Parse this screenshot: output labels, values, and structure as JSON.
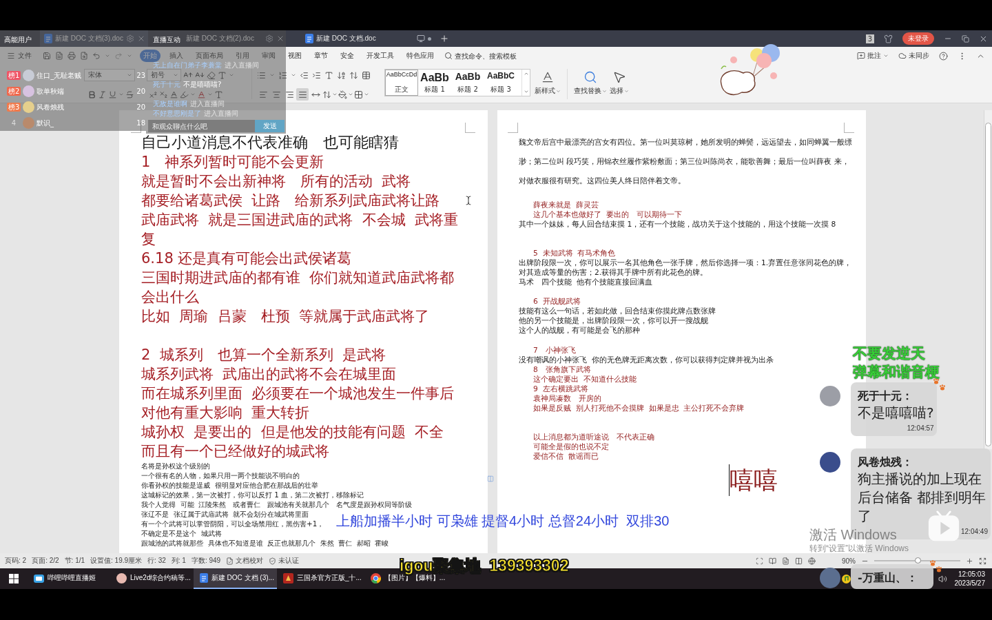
{
  "window": {
    "tabs": [
      {
        "label": "新建 DOC 文档(3).doc",
        "selected": true
      },
      {
        "label": "新建 DOC 文档(2).doc",
        "selected": false
      },
      {
        "label": "新建 DOC 文档.doc",
        "selected": false
      }
    ],
    "window_count": "3",
    "login_button": "未登录"
  },
  "menu": {
    "file": "文件",
    "tabs": [
      {
        "label": "开始",
        "selected": true
      },
      {
        "label": "插入",
        "selected": false
      },
      {
        "label": "页面布局",
        "selected": false
      },
      {
        "label": "引用",
        "selected": false
      },
      {
        "label": "审阅",
        "selected": false
      },
      {
        "label": "视图",
        "selected": false
      },
      {
        "label": "章节",
        "selected": false
      },
      {
        "label": "安全",
        "selected": false
      },
      {
        "label": "开发工具",
        "selected": false
      },
      {
        "label": "特色应用",
        "selected": false
      }
    ],
    "search": {
      "placeholder": "查找命令、搜索模板"
    },
    "comment": "批注",
    "sync": "未同步"
  },
  "ribbon": {
    "font_name": "宋体",
    "font_size": "初号",
    "align_buttons": [
      {
        "selected": false
      },
      {
        "selected": false
      },
      {
        "selected": false
      },
      {
        "selected": true
      },
      {
        "selected": false
      }
    ],
    "styles": [
      {
        "sample": "AaBbCcDd",
        "label": "正文",
        "selected": true
      },
      {
        "sample": "AaBb",
        "label": "标题 1",
        "selected": false
      },
      {
        "sample": "AaBb",
        "label": "标题 2",
        "selected": false
      },
      {
        "sample": "AaBbC",
        "label": "标题 3",
        "selected": false
      }
    ],
    "new_style": "新样式",
    "find_replace": "查找替换",
    "select": "选择"
  },
  "document": {
    "pages": [
      {
        "blocks": [
          {
            "lines": [
              {
                "kind": "title",
                "text": "自己小道消息不代表准确　也可能瞎猜"
              },
              {
                "kind": "large",
                "text": "1　神系列暂时可能不会更新"
              },
              {
                "kind": "large",
                "text": "就是暂时不会出新神将　所有的活动  武将"
              },
              {
                "kind": "large",
                "text": "都要给诸葛武侯  让路　给新系列武庙武将让路"
              },
              {
                "kind": "large",
                "text": "武庙武将  就是三国进武庙的武将  不会城  武将重"
              },
              {
                "kind": "large",
                "text": "复"
              },
              {
                "kind": "large",
                "text": "6.18 还是真有可能会出武侯诸葛"
              },
              {
                "kind": "large",
                "text": "三国时期进武庙的都有谁  你们就知道武庙武将都"
              },
              {
                "kind": "large",
                "text": "会出什么"
              },
              {
                "kind": "large",
                "text": "比如  周瑜  吕蒙　杜预  等就属于武庙武将了"
              }
            ]
          },
          {
            "lines": [
              {
                "kind": "large",
                "text": "2  城系列　也算一个全新系列  是武将"
              },
              {
                "kind": "large",
                "text": "城系列武将  武庙出的武将不会在城里面"
              },
              {
                "kind": "large",
                "text": "而在城系列里面  必须要在一个城池发生一件事后"
              },
              {
                "kind": "large",
                "text": "对他有重大影响  重大转折"
              },
              {
                "kind": "large",
                "text": "城孙权  是要出的  但是他发的技能有问题  不全"
              },
              {
                "kind": "large",
                "text": "而且有一个已经做好的城武将"
              },
              {
                "kind": "small",
                "text": "名将是孙权这个级别的"
              },
              {
                "kind": "small",
                "text": "一个很有名的人物，如果只用一两个技能说不明白的"
              },
              {
                "kind": "small",
                "text": "你看孙权的技能是逞威  很明显对应他合肥在那战后的壮举"
              },
              {
                "kind": "small",
                "text": "这城标记的效果，第一次被打，你可以反打 1 血，第二次被打，移除标记"
              },
              {
                "kind": "small",
                "text": "我个人觉得  可能  江陵朱然　或者曹仁　跟城池有关就那几个　名气度是跟孙权同等阶级"
              },
              {
                "kind": "small",
                "text": "张辽不是  张辽属于武庙武将  就不会划分在城武将里面"
              },
              {
                "kind": "small",
                "text": "有一个个武将可以掌管阴阳，可以全场禁用红，黑伤害+1，"
              },
              {
                "kind": "small",
                "text": "不确定是不是这个  城武将"
              },
              {
                "kind": "small",
                "text": "跟城池的武将就那些  具体也不知道是谁  反正也就那几个  朱然  曹仁  郝昭  霍峻"
              }
            ]
          }
        ]
      },
      {
        "blocks": [
          {
            "lines": [
              {
                "kind": "intro",
                "text": "魏文帝后宫中最漂亮的宫女有四位。第一位叫莫琼树，她所发明的蝉鬓，远远望去，如同蝉翼一般缥"
              },
              {
                "kind": "intro",
                "text": "渺；第二位叫 段巧笑，用锦衣丝履作紫粉敷面；第三位叫陈尚衣，能歌善舞；最后一位叫薛夜 来，"
              },
              {
                "kind": "intro",
                "text": "对做衣服很有研究。这四位美人终日陪伴着文帝。"
              }
            ]
          },
          {
            "lines": [
              {
                "kind": "note",
                "text": "薛夜来就是  薛灵芸"
              },
              {
                "kind": "note",
                "text": "这几个基本也做好了  要出的　可以期待一下"
              },
              {
                "kind": "body",
                "text": "其中一个妹妹，每人回合结束摸 1，还有一个技能，战功关于这个技能的，用这个技能一次摸 8"
              }
            ]
          },
          {
            "lines": [
              {
                "kind": "note",
                "text": "5  未知武将  有马术角色"
              },
              {
                "kind": "body",
                "text": "出牌阶段限一次，你可以展示一名其他角色一张手牌，然后你选择一项：1.弃置任意张同花色的牌，"
              },
              {
                "kind": "body",
                "text": "对其造成等量的伤害；2.获得其手牌中所有此花色的牌。"
              },
              {
                "kind": "body",
                "text": "马术　四个技能  他有个技能直接回满血"
              }
            ]
          },
          {
            "lines": [
              {
                "kind": "note",
                "text": "6  开战舰武将"
              },
              {
                "kind": "body",
                "text": "技能有这么一句话，若如此做，回合结束你摸此牌点数张牌"
              },
              {
                "kind": "body",
                "text": "他的另一个技能是，出牌阶段限一次，你可以开一搜战舰"
              },
              {
                "kind": "body",
                "text": "这个人的战舰，有可能是会飞的那种"
              }
            ]
          },
          {
            "lines": [
              {
                "kind": "note",
                "text": "7　小神张飞"
              },
              {
                "kind": "body",
                "text": "没有嘲讽的小神张飞  你的无色牌无距离次数，你可以获得判定牌并视为出杀"
              },
              {
                "kind": "note",
                "text": "8　张角旗下武将"
              },
              {
                "kind": "note",
                "text": "这个确定要出  不知道什么技能"
              },
              {
                "kind": "note",
                "text": "9  左右横跳武将"
              },
              {
                "kind": "note",
                "text": "袁神局凑数　开房的"
              },
              {
                "kind": "note",
                "text": "如果是反贼  别人打死他不会摸牌  如果是忠  主公打死不会弃牌"
              }
            ]
          },
          {
            "lines": [
              {
                "kind": "note",
                "text": "以上消息都为道听途说　不代表正确"
              },
              {
                "kind": "note",
                "text": "可能全是假的也说不定"
              },
              {
                "kind": "note",
                "text": "爱信不信  散谣而已"
              }
            ]
          },
          {
            "lines": [
              {
                "kind": "typing",
                "text": "嘻嘻"
              }
            ]
          }
        ]
      }
    ]
  },
  "status_bar": {
    "items": [
      "页码: 2",
      "页面: 2/2",
      "节: 1/1",
      "设置值: 19.9厘米",
      "行: 32",
      "列: 1",
      "字数: 949"
    ],
    "proofread": "文档校对",
    "certification": "未认证",
    "zoom": "90%",
    "zoom_slider": {
      "level": 0.5
    }
  },
  "taskbar": {
    "apps": [
      {
        "label": "哔哩哔哩直播姬",
        "selected": false
      },
      {
        "label": "Live2d综合约稿等...",
        "selected": false
      },
      {
        "label": "新建 DOC 文档 (3)...",
        "selected": true
      },
      {
        "label": "三国杀官方正版_十...",
        "selected": false
      },
      {
        "label": "【图片】【爆料】...",
        "selected": false
      }
    ],
    "time": "12:05:03",
    "date": "2023/5/27"
  },
  "live_overlay": {
    "rank_panel": {
      "title": "高能用户",
      "rows": [
        {
          "kind": "badge",
          "rank": "榜1",
          "name": "住口_无耻老贼",
          "score": "23"
        },
        {
          "kind": "badge",
          "rank": "榜2",
          "name": "歌单秋端",
          "score": "20"
        },
        {
          "kind": "badge",
          "rank": "榜3",
          "name": "风卷烛残",
          "score": "20"
        },
        {
          "kind": "plain",
          "rank": "4",
          "name": "默识_",
          "score": "18"
        }
      ]
    },
    "interaction_panel": {
      "title": "直播互动",
      "messages": [
        {
          "kind": "enter",
          "user": "无上自在门弟子李蓑棠",
          "text": "进入直播间"
        },
        {
          "kind": "chat",
          "user": "死于十元",
          "text": "不是嘻嘻喵?"
        },
        {
          "kind": "enter",
          "user": "无敌是谁啊",
          "text": "进入直播间"
        },
        {
          "kind": "enter",
          "user": "不好意思刚是了",
          "text": "进入直播间"
        }
      ],
      "input": {
        "placeholder": "和观众聊点什么吧"
      },
      "send_button": "发送"
    },
    "schedule_text": "上船加播半小时 可枭雄 提督4小时 总督24小时  双排30",
    "group_text": "igou聚集地  139393302",
    "notice": [
      "不要发逆天",
      "弹幕和谐音梗"
    ],
    "chat_bubbles": [
      {
        "user": "死于十元：",
        "text": "不是嘻嘻喵?",
        "time": "12:04:57",
        "paw_badge": true
      },
      {
        "user": "风卷烛残：",
        "text": "狗主播说的加上现在后台储备 都排到明年了",
        "time": "12:04:49",
        "paw_badge": false
      },
      {
        "user": "-万重山、：",
        "paw_badge": true
      }
    ]
  },
  "windows_activation": [
    "激活 Windows",
    "转到“设置”以激活 Windows"
  ]
}
